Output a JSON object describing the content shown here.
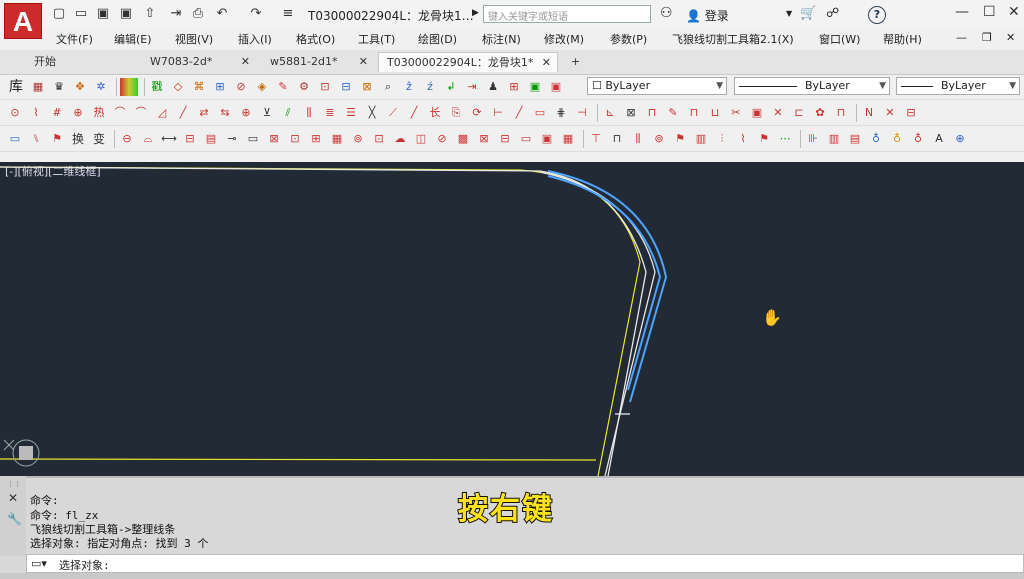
{
  "app": {
    "button_letter": "A",
    "doc_title": "T03000022904L：龙骨块1…",
    "search_placeholder": "键入关键字或短语",
    "login_label": "登录"
  },
  "quick_access": {
    "icons": [
      "new-icon",
      "open-icon",
      "save-icon",
      "saveas-icon",
      "share-icon",
      "export-icon",
      "print-icon",
      "undo-icon",
      "redo-icon",
      "customize-icon"
    ]
  },
  "menu": [
    "文件(F)",
    "编辑(E)",
    "视图(V)",
    "插入(I)",
    "格式(O)",
    "工具(T)",
    "绘图(D)",
    "标注(N)",
    "修改(M)",
    "参数(P)",
    "飞狼线切割工具箱2.1(X)",
    "窗口(W)",
    "帮助(H)"
  ],
  "tabs": [
    {
      "label": "开始",
      "closable": false
    },
    {
      "label": "W7083-2d*",
      "closable": true
    },
    {
      "label": "w5881-2d1*",
      "closable": true
    },
    {
      "label": "T03000022904L：龙骨块1*",
      "closable": true,
      "active": true
    }
  ],
  "new_tab_label": "+",
  "toolbar1": {
    "first_label": "库",
    "layer_combo": "ByLayer",
    "linetype_combo": "ByLayer",
    "lineweight_combo": "ByLayer"
  },
  "toolbar_buttons": {
    "swap_label": "换",
    "change_label": "变"
  },
  "canvas": {
    "view_label": "[-][俯视][二维线框]",
    "background": "#222a35",
    "yellow": "#e6e62a",
    "white": "#e8e8e8",
    "blue": "#4da3ff"
  },
  "command": {
    "lines": [
      "命令:",
      "命令: fl_zx",
      "飞狼线切割工具箱->整理线条",
      "选择对象: 指定对角点: 找到 3 个"
    ],
    "prompt": "选择对象:"
  },
  "caption": "按右键",
  "colors": {
    "accent": "#cc2b2b",
    "caption": "#ffe21a"
  }
}
